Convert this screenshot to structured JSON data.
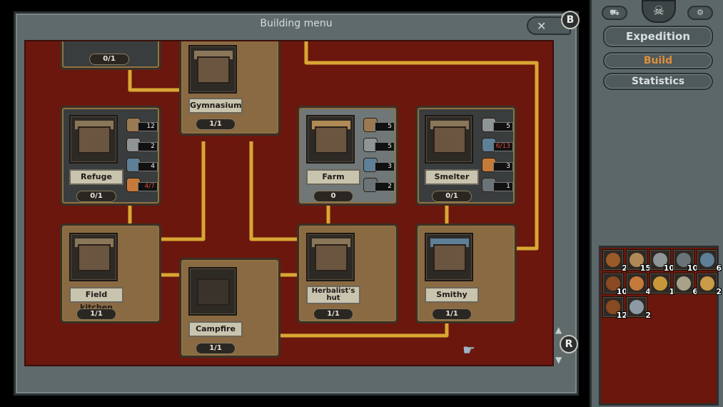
{
  "window": {
    "title": "Building menu",
    "close_glyph": "✕",
    "close_hotkey": "B",
    "scroll_hotkey": "R"
  },
  "colors": {
    "board": "#6b170d",
    "path": "#d8a733",
    "accent_build": "#e08e3c"
  },
  "buildings": [
    {
      "key": "top-left",
      "name": "",
      "count": "0/1",
      "state": "locked",
      "resources": []
    },
    {
      "key": "gymnasium",
      "name": "Gymnasium",
      "count": "1/1",
      "state": "built",
      "resources": []
    },
    {
      "key": "refuge",
      "name": "Refuge",
      "count": "0/1",
      "state": "locked",
      "resources": [
        {
          "icon": "planks-icon",
          "value": "12",
          "red": false
        },
        {
          "icon": "stone-icon",
          "value": "2",
          "red": false
        },
        {
          "icon": "metal-icon",
          "value": "4",
          "red": false
        },
        {
          "icon": "food-icon",
          "value": "4/7",
          "red": true
        }
      ]
    },
    {
      "key": "farm",
      "name": "Farm",
      "count": "0",
      "state": "avail",
      "resources": [
        {
          "icon": "planks-icon",
          "value": "5",
          "red": false
        },
        {
          "icon": "stone-icon",
          "value": "5",
          "red": false
        },
        {
          "icon": "metal-icon",
          "value": "3",
          "red": false
        },
        {
          "icon": "ore-icon",
          "value": "2",
          "red": false
        }
      ]
    },
    {
      "key": "smelter",
      "name": "Smelter",
      "count": "0/1",
      "state": "locked",
      "resources": [
        {
          "icon": "stone-icon",
          "value": "5",
          "red": false
        },
        {
          "icon": "metal-icon",
          "value": "6/13",
          "red": true
        },
        {
          "icon": "food-icon",
          "value": "3",
          "red": false
        },
        {
          "icon": "ore-icon",
          "value": "1",
          "red": false
        }
      ]
    },
    {
      "key": "field-kitchen",
      "name": "Field kitchen",
      "count": "1/1",
      "state": "built",
      "resources": []
    },
    {
      "key": "campfire",
      "name": "Campfire",
      "count": "1/1",
      "state": "built",
      "resources": []
    },
    {
      "key": "herbalists-hut",
      "name": "Herbalist's hut",
      "count": "1/1",
      "state": "built",
      "resources": []
    },
    {
      "key": "smithy",
      "name": "Smithy",
      "count": "1/1",
      "state": "built",
      "resources": []
    }
  ],
  "side": {
    "skull_glyph": "☠",
    "left_icon": "⛟",
    "right_icon": "⚙",
    "buttons": {
      "expedition": "Expedition",
      "build": "Build",
      "statistics": "Statistics"
    }
  },
  "inventory": [
    {
      "icon": "wood-log-icon",
      "qty": "2",
      "color": "#9a5a2a"
    },
    {
      "icon": "planks-icon",
      "qty": "15",
      "color": "#b08a55"
    },
    {
      "icon": "stone-icon",
      "qty": "10",
      "color": "#8f9496"
    },
    {
      "icon": "ore-icon",
      "qty": "10",
      "color": "#6a7478"
    },
    {
      "icon": "metal-icon",
      "qty": "6",
      "color": "#5d7f97"
    },
    {
      "icon": "wood-log-icon",
      "qty": "10",
      "color": "#8b4a24"
    },
    {
      "icon": "food-icon",
      "qty": "4",
      "color": "#c67a3a"
    },
    {
      "icon": "herb-icon",
      "qty": "1",
      "color": "#c8973a"
    },
    {
      "icon": "scroll-icon",
      "qty": "6",
      "color": "#a8a28a"
    },
    {
      "icon": "book-icon",
      "qty": "2",
      "color": "#c99a48"
    },
    {
      "icon": "leather-icon",
      "qty": "12",
      "color": "#8a4a20"
    },
    {
      "icon": "orb-icon",
      "qty": "2",
      "color": "#8d9aa4"
    }
  ]
}
